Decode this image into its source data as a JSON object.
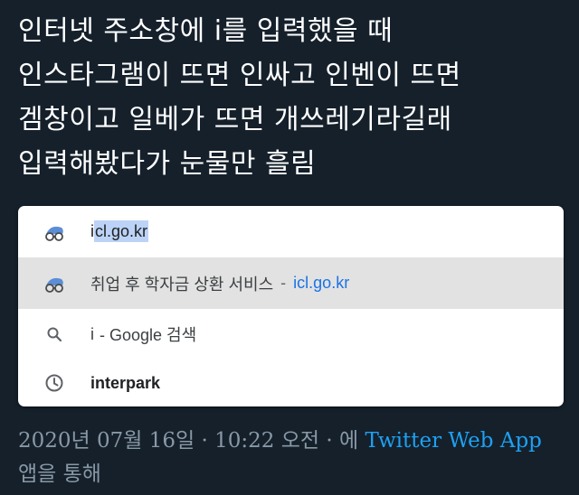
{
  "tweet": {
    "lines": [
      "인터넷 주소창에 i를 입력했을 때",
      "인스타그램이 뜨면 인싸고 인벤이 뜨면",
      "겜창이고 일베가 뜨면 개쓰레기라길래",
      "입력해봤다가 눈물만 흘림"
    ]
  },
  "autocomplete": {
    "input": {
      "typed": "i",
      "selected_completion": "cl.go.kr",
      "icon": "site-favicon-icon"
    },
    "suggestions": [
      {
        "title": "취업 후 학자금 상환 서비스",
        "separator": "-",
        "url": "icl.go.kr",
        "icon": "site-favicon-icon"
      },
      {
        "typed": "i",
        "text": "- Google 검색",
        "icon": "search-icon"
      },
      {
        "text": "interpark",
        "icon": "history-clock-icon"
      }
    ]
  },
  "meta": {
    "date": "2020년 07월 16일",
    "dot1": "·",
    "time": "10:22 오전",
    "dot2": "·",
    "via_prefix": "에",
    "source": "Twitter Web App",
    "via_suffix": "앱을 통해"
  },
  "colors": {
    "background": "#15202b",
    "text": "#ffffff",
    "muted": "#8899a6",
    "link": "#1da1f2",
    "url": "#1a73e8",
    "selection": "#bcd3f7",
    "highlight_row": "#e2e2e2"
  }
}
